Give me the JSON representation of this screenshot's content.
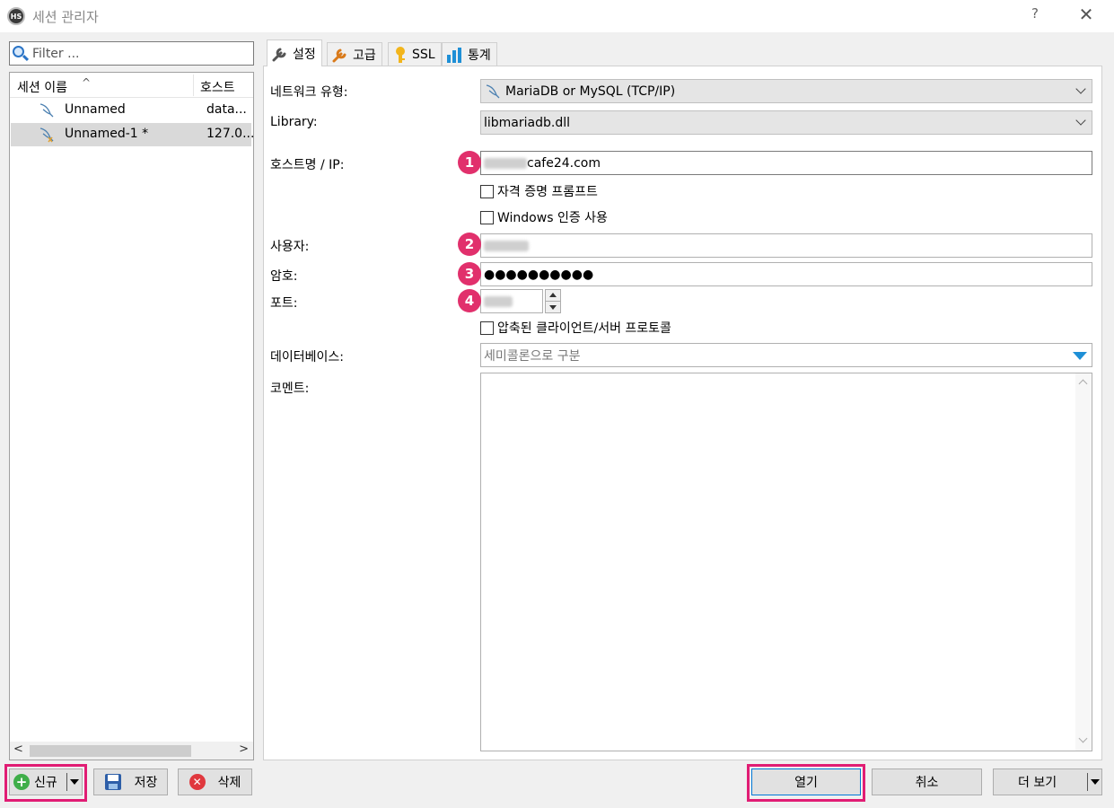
{
  "window": {
    "title": "세션 관리자",
    "help": "?",
    "close": "✕"
  },
  "filter": {
    "placeholder": "Filter ..."
  },
  "tree": {
    "col_name": "세션 이름",
    "col_host": "호스트",
    "sort_indicator": "^",
    "rows": [
      {
        "name": "Unnamed",
        "host": "data...",
        "selected": false
      },
      {
        "name": "Unnamed-1 *",
        "host": "127.0...",
        "selected": true
      }
    ]
  },
  "tabs": [
    {
      "label": "설정",
      "icon": "wrench-icon",
      "active": true
    },
    {
      "label": "고급",
      "icon": "wrench-orange-icon",
      "active": false
    },
    {
      "label": "SSL",
      "icon": "key-icon",
      "active": false
    },
    {
      "label": "통계",
      "icon": "bar-chart-icon",
      "active": false
    }
  ],
  "settings": {
    "network_type_label": "네트워크 유형:",
    "network_type_value": "MariaDB or MySQL (TCP/IP)",
    "library_label": "Library:",
    "library_value": "libmariadb.dll",
    "host_label": "호스트명 / IP:",
    "host_value": "cafe24.com",
    "credential_prompt": "자격 증명 프롬프트",
    "windows_auth": "Windows 인증 사용",
    "user_label": "사용자:",
    "password_label": "암호:",
    "password_value": "●●●●●●●●●●",
    "port_label": "포트:",
    "compressed_protocol": "압축된 클라이언트/서버 프로토콜",
    "database_label": "데이터베이스:",
    "database_placeholder": "세미콜론으로 구분",
    "comment_label": "코멘트:"
  },
  "badges": [
    "1",
    "2",
    "3",
    "4"
  ],
  "buttons": {
    "new": "신규",
    "save": "저장",
    "delete": "삭제",
    "open": "열기",
    "cancel": "취소",
    "more": "더 보기"
  },
  "colors": {
    "highlight": "#e11d74",
    "badge": "#e1306c"
  }
}
